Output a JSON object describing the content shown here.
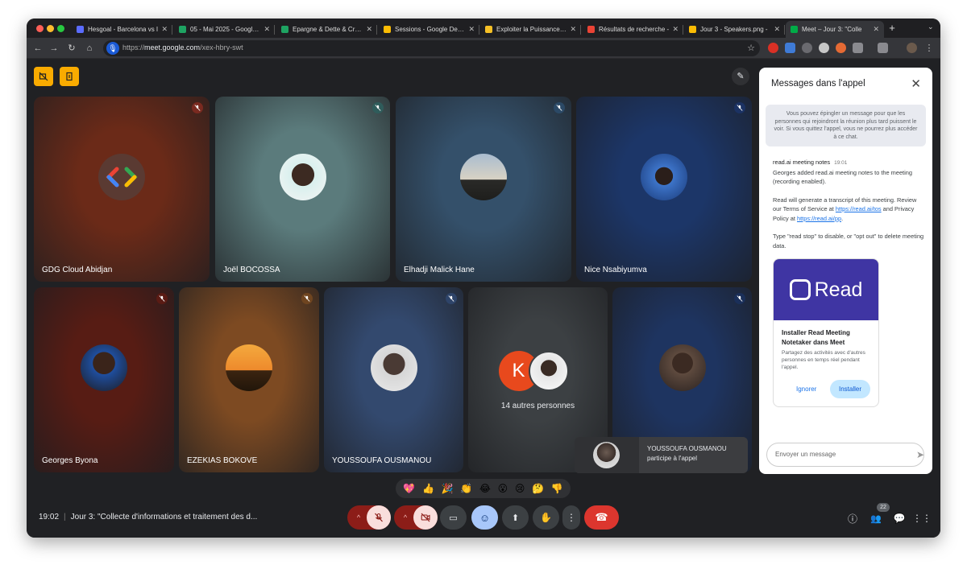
{
  "browser": {
    "tabs": [
      {
        "title": "Hesgoal - Barcelona vs I",
        "favicon_color": "#5b6cff"
      },
      {
        "title": "05 - Mai 2025 - Google S",
        "favicon_color": "#1ea362"
      },
      {
        "title": "Epargne & Dette & Créati",
        "favicon_color": "#1ea362"
      },
      {
        "title": "Sessions - Google Develo",
        "favicon_color": "#fbbc04"
      },
      {
        "title": "Exploiter la Puissance de",
        "favicon_color": "#f6c026"
      },
      {
        "title": "Résultats de recherche -",
        "favicon_color": "#ea4335"
      },
      {
        "title": "Jour 3 - Speakers.png -",
        "favicon_color": "#fbbc04"
      },
      {
        "title": "Meet – Jour 3: \"Colle",
        "favicon_color": "#00ac47"
      }
    ],
    "url_prefix": "https://",
    "url_host": "meet.google.com",
    "url_path": "/xex-hbry-swt"
  },
  "participants": [
    {
      "name": "GDG Cloud Abidjan",
      "bg": "#6b2a18"
    },
    {
      "name": "Joël BOCOSSA",
      "bg": "#5b7b7c"
    },
    {
      "name": "Elhadji Malick Hane",
      "bg": "#34506a"
    },
    {
      "name": "Nice Nsabiyumva",
      "bg": "#1c3668"
    },
    {
      "name": "Georges Byona",
      "bg": "#571c14"
    },
    {
      "name": "EZEKIAS BOKOVE",
      "bg": "#7d4a22"
    },
    {
      "name": "YOUSSOUFA OUSMANOU",
      "bg": "#33496e"
    },
    {
      "name": "14 autres personnes",
      "bg": "#3c4043",
      "initial": "K"
    },
    {
      "name": "",
      "bg": "#1e3460"
    }
  ],
  "chat": {
    "title": "Messages dans l'appel",
    "info": "Vous pouvez épingler un message pour que les personnes qui rejoindront la réunion plus tard puissent le voir. Si vous quittez l'appel, vous ne pourrez plus accéder à ce chat.",
    "sender": "read.ai meeting notes",
    "time": "19:01",
    "p1": "Georges added read.ai meeting notes to the meeting (recording enabled).",
    "p2a": "Read will generate a transcript of this meeting. Review our Terms of Service at ",
    "link1": "https://read.ai/tos",
    "p2b": " and Privacy Policy at ",
    "link2": "https://read.ai/pp",
    "p2c": ".",
    "p3": "Type \"read stop\" to disable, or \"opt out\" to delete meeting data.",
    "card": {
      "brand": "Read",
      "title": "Installer Read Meeting Notetaker dans Meet",
      "desc": "Partagez des activités avec d'autres personnes en temps réel pendant l'appel.",
      "ignore": "Ignorer",
      "install": "Installer"
    },
    "input_placeholder": "Envoyer un message"
  },
  "toast": {
    "line1": "YOUSSOUFA OUSMANOU",
    "line2": "participe à l'appel"
  },
  "reactions": [
    "💖",
    "👍",
    "🎉",
    "👏",
    "😂",
    "😮",
    "😢",
    "🤔",
    "👎"
  ],
  "meeting": {
    "time": "19:02",
    "title": "Jour 3: \"Collecte d'informations et traitement des d...",
    "people_count": "22"
  }
}
